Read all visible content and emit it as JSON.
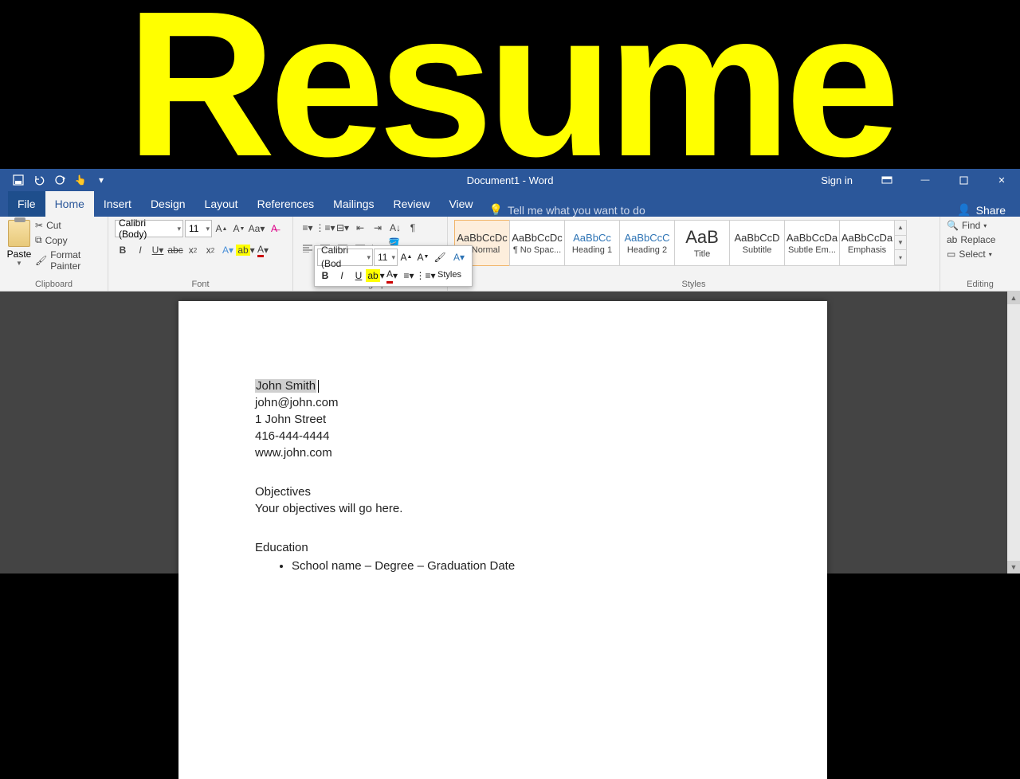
{
  "banner": {
    "text": "Resume"
  },
  "titlebar": {
    "title": "Document1  -  Word",
    "signin": "Sign in"
  },
  "tabs": {
    "file": "File",
    "home": "Home",
    "insert": "Insert",
    "design": "Design",
    "layout": "Layout",
    "references": "References",
    "mailings": "Mailings",
    "review": "Review",
    "view": "View",
    "tellme": "Tell me what you want to do",
    "share": "Share"
  },
  "ribbon": {
    "clipboard": {
      "paste": "Paste",
      "cut": "Cut",
      "copy": "Copy",
      "format_painter": "Format Painter",
      "label": "Clipboard"
    },
    "font": {
      "name": "Calibri (Body)",
      "size": "11",
      "label": "Font"
    },
    "paragraph": {
      "label": "Paragraph"
    },
    "styles": {
      "label": "Styles",
      "items": [
        {
          "prev": "AaBbCcDc",
          "name": "¶ Normal",
          "cls": ""
        },
        {
          "prev": "AaBbCcDc",
          "name": "¶ No Spac...",
          "cls": ""
        },
        {
          "prev": "AaBbCc",
          "name": "Heading 1",
          "cls": "blue"
        },
        {
          "prev": "AaBbCcC",
          "name": "Heading 2",
          "cls": "blue"
        },
        {
          "prev": "AaB",
          "name": "Title",
          "cls": "big"
        },
        {
          "prev": "AaBbCcD",
          "name": "Subtitle",
          "cls": ""
        },
        {
          "prev": "AaBbCcDa",
          "name": "Subtle Em...",
          "cls": ""
        },
        {
          "prev": "AaBbCcDa",
          "name": "Emphasis",
          "cls": ""
        }
      ]
    },
    "editing": {
      "find": "Find",
      "replace": "Replace",
      "select": "Select",
      "label": "Editing"
    }
  },
  "minitoolbar": {
    "font": "Calibri (Bod",
    "size": "11",
    "styles": "Styles"
  },
  "doc": {
    "name": "John Smith",
    "email": "john@john.com",
    "street": "1 John Street",
    "phone": "416-444-4444",
    "website": "www.john.com",
    "objectives_h": "Objectives",
    "objectives_t": "Your objectives will go here.",
    "education_h": "Education",
    "education_b0": "School name – Degree – Graduation Date"
  }
}
